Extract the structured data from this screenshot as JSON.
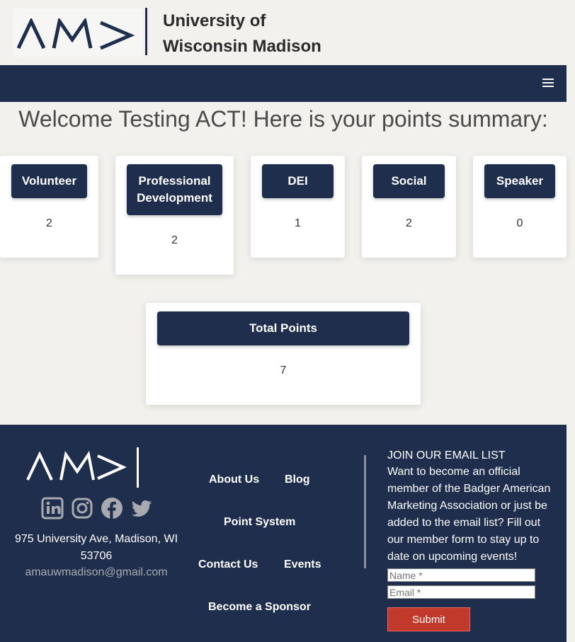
{
  "header": {
    "logo_text": "AM>",
    "university_line1": "University of",
    "university_line2": "Wisconsin Madison"
  },
  "nav": {
    "menu_icon": "hamburger-menu-icon"
  },
  "welcome": "Welcome Testing ACT! Here is your points summary:",
  "categories": [
    {
      "label": "Volunteer",
      "value": "2"
    },
    {
      "label": "Professional Development",
      "value": "2"
    },
    {
      "label": "DEI",
      "value": "1"
    },
    {
      "label": "Social",
      "value": "2"
    },
    {
      "label": "Speaker",
      "value": "0"
    }
  ],
  "total": {
    "label": "Total Points",
    "value": "7"
  },
  "footer": {
    "social_icons": [
      "linkedin-icon",
      "instagram-icon",
      "facebook-icon",
      "twitter-icon"
    ],
    "address": "975 University Ave, Madison, WI 53706",
    "email": "amauwmadison@gmail.com",
    "links": {
      "about": "About Us",
      "blog": "Blog",
      "points": "Point System",
      "contact": "Contact Us",
      "events": "Events",
      "sponsor": "Become a Sponsor"
    },
    "join_title": "JOIN OUR EMAIL LIST",
    "join_text": "Want to become an official member of the Badger American Marketing Association or just be added to the email list? Fill out our member form to stay up to date on upcoming events!",
    "name_placeholder": "Name *",
    "email_placeholder": "Email *",
    "submit_label": "Submit"
  },
  "colors": {
    "navy": "#1f2e4d",
    "submit_red": "#c0392b",
    "page_bg": "#f2f1ee"
  }
}
